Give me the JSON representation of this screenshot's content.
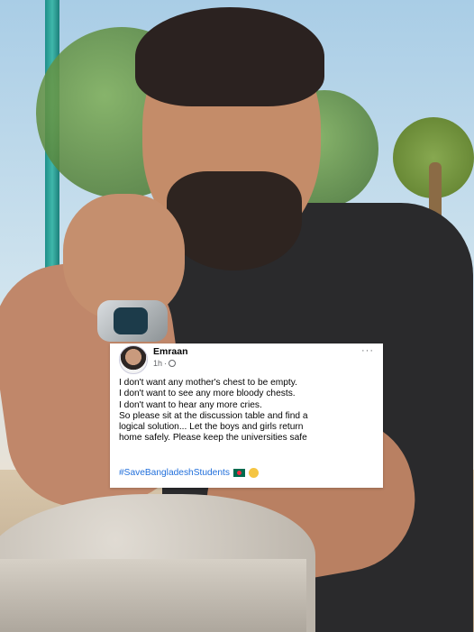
{
  "post": {
    "author": "Emraan",
    "timestamp": "1h",
    "separator": "·",
    "more": "···",
    "lines": [
      "I don't want any mother's chest to be empty.",
      "I don't want to see any more bloody chests.",
      "I don't want to hear any more cries.",
      "So please sit at the discussion table and find a",
      "logical solution... Let the boys and girls return",
      "home safely. Please keep the universities safe"
    ],
    "hashtag": "#SaveBangladeshStudents",
    "icons": [
      "globe-icon",
      "bangladesh-flag-icon",
      "clapping-hands-icon"
    ],
    "hashtag_color": "#216fdb"
  }
}
